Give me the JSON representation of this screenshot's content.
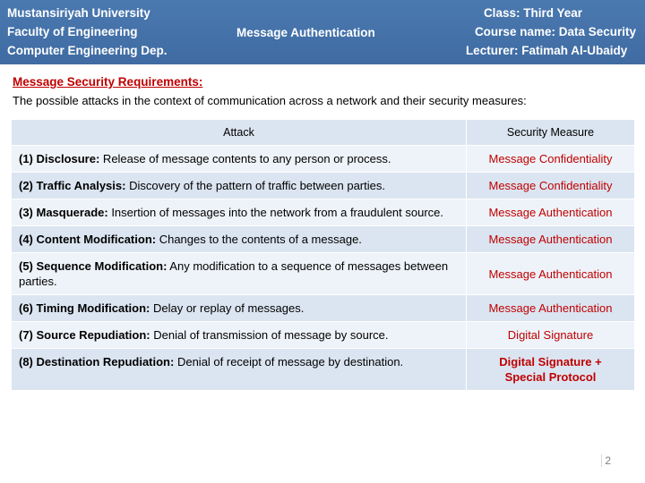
{
  "header": {
    "left_lines": [
      "Mustansiriyah University",
      "Faculty of Engineering",
      "Computer Engineering Dep."
    ],
    "center_title": "Message Authentication",
    "right_lines": [
      "Class: Third Year",
      "Course name: Data Security",
      "Lecturer: Fatimah Al-Ubaidy"
    ],
    "background_color": "#4472a8"
  },
  "body": {
    "section_title": "Message Security Requirements:",
    "section_title_color": "#c00000",
    "intro": "The possible attacks in the context of communication across a network and their security measures:"
  },
  "table": {
    "columns": [
      "Attack",
      "Security Measure"
    ],
    "rows": [
      {
        "attack_label": "(1) Disclosure:",
        "attack_text": " Release of message contents to any person or process.",
        "measure": "Message Confidentiality"
      },
      {
        "attack_label": "(2) Traffic Analysis:",
        "attack_text": " Discovery of the pattern of traffic between parties.",
        "measure": "Message Confidentiality"
      },
      {
        "attack_label": "(3) Masquerade:",
        "attack_text": " Insertion of messages into the network from a fraudulent source.",
        "measure": "Message Authentication"
      },
      {
        "attack_label": "(4) Content Modification:",
        "attack_text": " Changes to the contents of a message.",
        "measure": "Message Authentication"
      },
      {
        "attack_label": "(5) Sequence Modification:",
        "attack_text": " Any modification to a sequence of messages between parties.",
        "measure": "Message Authentication"
      },
      {
        "attack_label": "(6) Timing Modification:",
        "attack_text": " Delay or replay of messages.",
        "measure": "Message Authentication"
      },
      {
        "attack_label": "(7) Source Repudiation:",
        "attack_text": " Denial of transmission of message by source.",
        "measure": "Digital Signature"
      },
      {
        "attack_label": "(8) Destination Repudiation:",
        "attack_text": " Denial of receipt of message by destination.",
        "measure": "Digital Signature +\nSpecial Protocol"
      }
    ],
    "measure_color": "#c00000",
    "header_background": "#dbe5f1"
  },
  "footer": {
    "page_number": "2"
  }
}
